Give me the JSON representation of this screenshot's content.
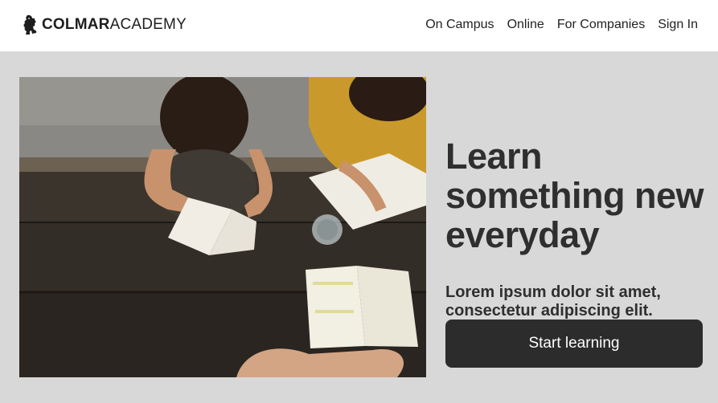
{
  "brand": {
    "logo_icon": "lion-rampant-icon",
    "name_bold": "COLMAR",
    "name_regular": "ACADEMY"
  },
  "nav": {
    "items": [
      {
        "label": "On Campus"
      },
      {
        "label": "Online"
      },
      {
        "label": "For Companies"
      },
      {
        "label": "Sign In"
      }
    ]
  },
  "hero": {
    "image_icon": "students-studying-photo",
    "headline": "Learn something new everyday",
    "subhead": "Lorem ipsum dolor sit amet, consectetur adipiscing elit.",
    "cta_label": "Start learning"
  },
  "colors": {
    "page_background": "#d8d8d8",
    "header_background": "#ffffff",
    "button_background": "#2c2c2c",
    "button_text": "#ffffff",
    "text": "#2f2f2f"
  }
}
